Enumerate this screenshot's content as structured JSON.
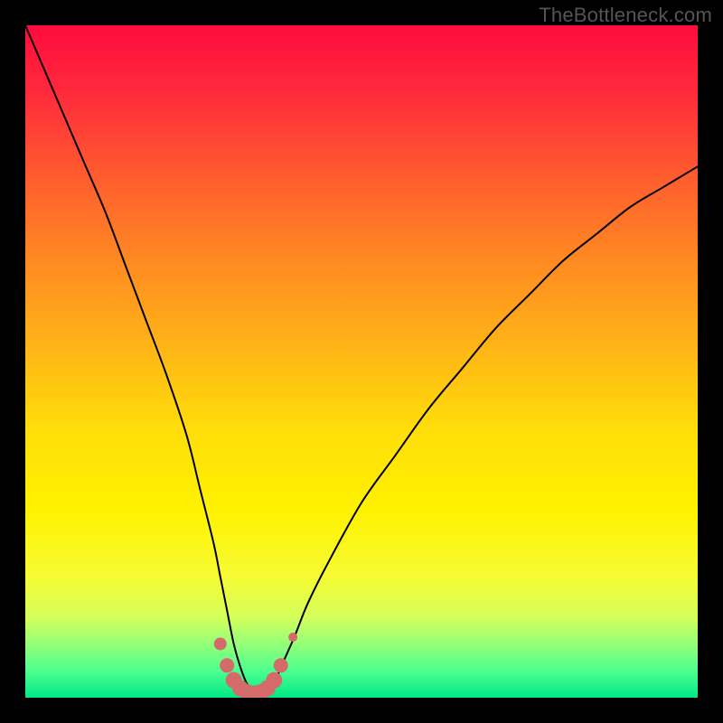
{
  "watermark": "TheBottleneck.com",
  "chart_data": {
    "type": "line",
    "title": "",
    "xlabel": "",
    "ylabel": "",
    "xlim": [
      0,
      100
    ],
    "ylim": [
      0,
      100
    ],
    "series": [
      {
        "name": "bottleneck-curve",
        "x": [
          0,
          3,
          6,
          9,
          12,
          15,
          18,
          21,
          24,
          26,
          28,
          29,
          30,
          31,
          32,
          33,
          34,
          35,
          36,
          37,
          38,
          40,
          42,
          45,
          50,
          55,
          60,
          65,
          70,
          75,
          80,
          85,
          90,
          95,
          100
        ],
        "y": [
          100,
          93,
          86,
          79,
          72,
          64,
          56,
          48,
          39,
          31,
          23,
          18,
          13,
          8,
          4.5,
          2,
          0.8,
          0.5,
          0.8,
          2,
          4.5,
          9,
          14,
          20,
          29,
          36,
          43,
          49,
          55,
          60,
          65,
          69,
          73,
          76,
          79
        ]
      }
    ],
    "markers": {
      "name": "highlight-band",
      "color": "#d46a6a",
      "x": [
        29.0,
        30.0,
        31.0,
        32.0,
        33.0,
        34.0,
        35.0,
        36.0,
        37.0,
        38.0,
        39.8
      ],
      "y": [
        8.0,
        4.8,
        2.6,
        1.4,
        0.8,
        0.6,
        0.8,
        1.4,
        2.6,
        4.8,
        9.0
      ],
      "size": [
        14,
        16,
        18,
        18,
        18,
        18,
        18,
        18,
        18,
        16,
        10
      ]
    },
    "gradient_stops": [
      {
        "offset": 0.0,
        "color": "#ff0b3e"
      },
      {
        "offset": 0.1,
        "color": "#ff2a3b"
      },
      {
        "offset": 0.22,
        "color": "#ff5a2f"
      },
      {
        "offset": 0.35,
        "color": "#ff8a22"
      },
      {
        "offset": 0.48,
        "color": "#ffb516"
      },
      {
        "offset": 0.6,
        "color": "#ffdd0a"
      },
      {
        "offset": 0.72,
        "color": "#fff200"
      },
      {
        "offset": 0.82,
        "color": "#f6fb33"
      },
      {
        "offset": 0.88,
        "color": "#d4ff5a"
      },
      {
        "offset": 0.92,
        "color": "#95ff78"
      },
      {
        "offset": 0.96,
        "color": "#4dff8f"
      },
      {
        "offset": 1.0,
        "color": "#00e887"
      }
    ],
    "curve_color": "#000000"
  }
}
